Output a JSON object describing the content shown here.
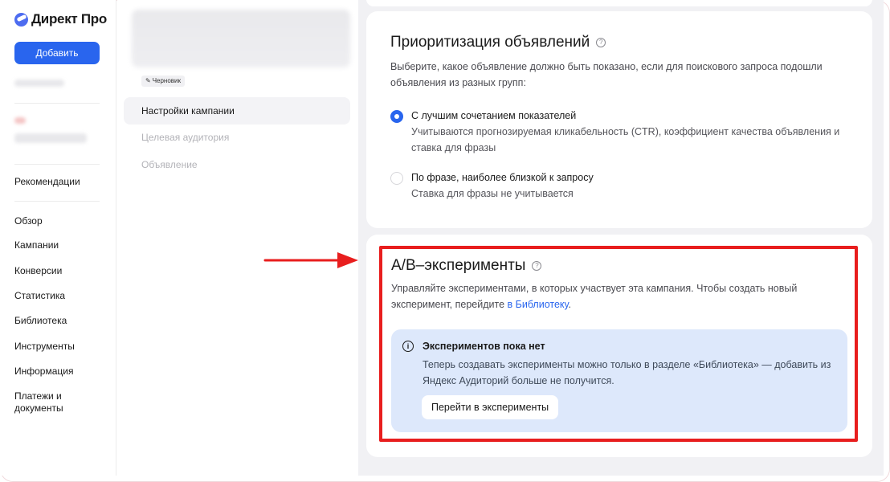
{
  "app": {
    "logo_text": "Директ Про",
    "add_button": "Добавить"
  },
  "nav": {
    "items": [
      {
        "label": "Рекомендации"
      },
      {
        "label": "Обзор"
      },
      {
        "label": "Кампании"
      },
      {
        "label": "Конверсии"
      },
      {
        "label": "Статистика"
      },
      {
        "label": "Библиотека"
      },
      {
        "label": "Инструменты"
      },
      {
        "label": "Информация"
      },
      {
        "label": "Платежи и документы"
      }
    ]
  },
  "campaign": {
    "draft_badge": "Черновик",
    "steps": [
      {
        "label": "Настройки кампании",
        "state": "active"
      },
      {
        "label": "Целевая аудитория",
        "state": "disabled"
      },
      {
        "label": "Объявление",
        "state": "disabled"
      }
    ]
  },
  "prioritization": {
    "title": "Приоритизация объявлений",
    "description": "Выберите, какое объявление должно быть показано, если для поискового запроса подошли объявления из разных групп:",
    "options": [
      {
        "label": "С лучшим сочетанием показателей",
        "sub": "Учитываются прогнозируемая кликабельность (CTR), коэффициент качества объявления и ставка для фразы",
        "checked": true
      },
      {
        "label": "По фразе, наиболее близкой к запросу",
        "sub": "Ставка для фразы не учитывается",
        "checked": false
      }
    ]
  },
  "ab": {
    "title": "A/B–эксперименты",
    "description_prefix": "Управляйте экспериментами, в которых участвует эта кампания. Чтобы создать новый эксперимент, перейдите ",
    "description_link": "в Библиотеку",
    "description_suffix": ".",
    "info_title": "Экспериментов пока нет",
    "info_text": "Теперь создавать эксперименты можно только в разделе «Библиотека» — добавить из Яндекс Аудиторий больше не получится.",
    "goto_button": "Перейти в эксперименты"
  },
  "colors": {
    "accent": "#2965ee",
    "highlight": "#e81e1e",
    "info_bg": "#dde8fb",
    "content_bg": "#f1f1f4"
  }
}
